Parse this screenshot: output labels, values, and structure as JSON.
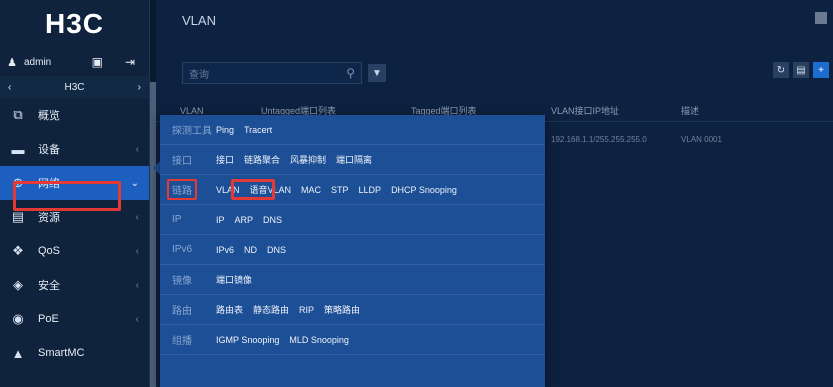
{
  "brand": {
    "logo_text": "H3C"
  },
  "user": {
    "name": "admin"
  },
  "device": {
    "name": "H3C"
  },
  "sidebar": {
    "items": [
      {
        "label": "概览",
        "icon": "dashboard-icon",
        "has_children": false
      },
      {
        "label": "设备",
        "icon": "device-icon",
        "has_children": true
      },
      {
        "label": "网络",
        "icon": "globe-icon",
        "has_children": true,
        "active": true
      },
      {
        "label": "资源",
        "icon": "database-icon",
        "has_children": true
      },
      {
        "label": "QoS",
        "icon": "qos-icon",
        "has_children": true
      },
      {
        "label": "安全",
        "icon": "shield-icon",
        "has_children": true
      },
      {
        "label": "PoE",
        "icon": "poe-icon",
        "has_children": true
      },
      {
        "label": "SmartMC",
        "icon": "smartmc-icon",
        "has_children": false
      }
    ]
  },
  "main": {
    "title": "VLAN",
    "search": {
      "placeholder": "查询"
    },
    "table": {
      "headers": [
        "VLAN",
        "Untagged端口列表",
        "Tagged端口列表",
        "VLAN接口IP地址",
        "描述"
      ],
      "rows": [
        {
          "ip": "192.168.1.1/255.255.255.0",
          "desc": "VLAN 0001"
        }
      ]
    }
  },
  "menu": {
    "rows": [
      {
        "category": "探测工具",
        "items": [
          "Ping",
          "Tracert"
        ]
      },
      {
        "category": "接口",
        "items": [
          "接口",
          "链路聚合",
          "风暴抑制",
          "端口隔离"
        ]
      },
      {
        "category": "链路",
        "items": [
          "VLAN",
          "语音VLAN",
          "MAC",
          "STP",
          "LLDP",
          "DHCP Snooping"
        ]
      },
      {
        "category": "IP",
        "items": [
          "IP",
          "ARP",
          "DNS"
        ]
      },
      {
        "category": "IPv6",
        "items": [
          "IPv6",
          "ND",
          "DNS"
        ]
      },
      {
        "category": "镜像",
        "items": [
          "端口镜像"
        ]
      },
      {
        "category": "路由",
        "items": [
          "路由表",
          "静态路由",
          "RIP",
          "策略路由"
        ]
      },
      {
        "category": "组播",
        "items": [
          "IGMP Snooping",
          "MLD Snooping"
        ]
      }
    ]
  },
  "colors": {
    "accent": "#1d5fbf",
    "menu_bg": "#1d4f96",
    "highlight": "#e53935"
  }
}
